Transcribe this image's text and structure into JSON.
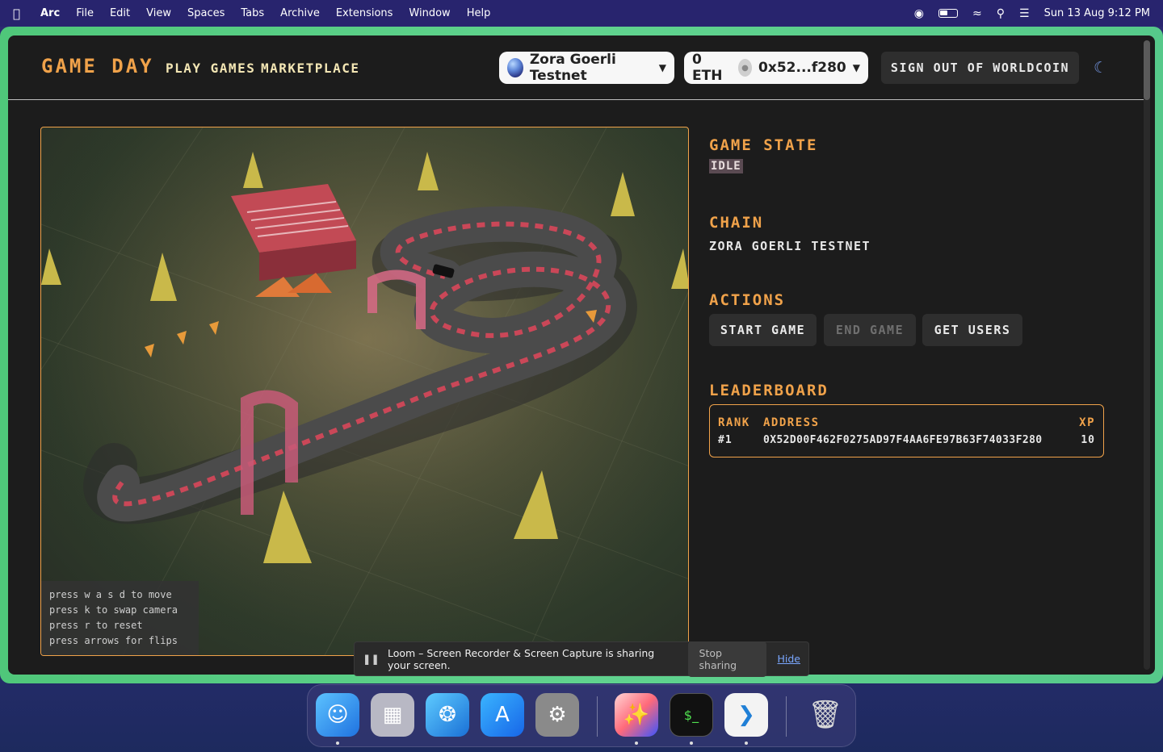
{
  "menubar": {
    "app": "Arc",
    "items": [
      "File",
      "Edit",
      "View",
      "Spaces",
      "Tabs",
      "Archive",
      "Extensions",
      "Window",
      "Help"
    ],
    "datetime": "Sun 13 Aug  9:12 PM"
  },
  "header": {
    "logo": "GAME DAY",
    "nav": [
      "PLAY GAMES",
      "MARKETPLACE"
    ],
    "network": "Zora Goerli Testnet",
    "balance": "0 ETH",
    "account": "0x52...f280",
    "signout": "SIGN OUT OF WORLDCOIN"
  },
  "game": {
    "instructions": [
      "press w a s d to move",
      "press k to swap camera",
      "press r to reset",
      "press arrows for flips"
    ]
  },
  "panel": {
    "game_state_title": "GAME STATE",
    "game_state_value": "IDLE",
    "chain_title": "CHAIN",
    "chain_value": "ZORA GOERLI TESTNET",
    "actions_title": "ACTIONS",
    "actions": [
      "START GAME",
      "END GAME",
      "GET USERS"
    ],
    "leaderboard_title": "LEADERBOARD",
    "leaderboard": {
      "columns": [
        "RANK",
        "ADDRESS",
        "XP"
      ],
      "rows": [
        {
          "rank": "#1",
          "address": "0X52D00F462F0275AD97F4AA6FE97B63F74033F280",
          "xp": "10"
        }
      ]
    }
  },
  "loom": {
    "message": "Loom – Screen Recorder & Screen Capture is sharing your screen.",
    "stop": "Stop sharing",
    "hide": "Hide"
  },
  "colors": {
    "accent": "#f0a24a",
    "frame": "#5bcd86",
    "background": "#1c1c1c"
  }
}
